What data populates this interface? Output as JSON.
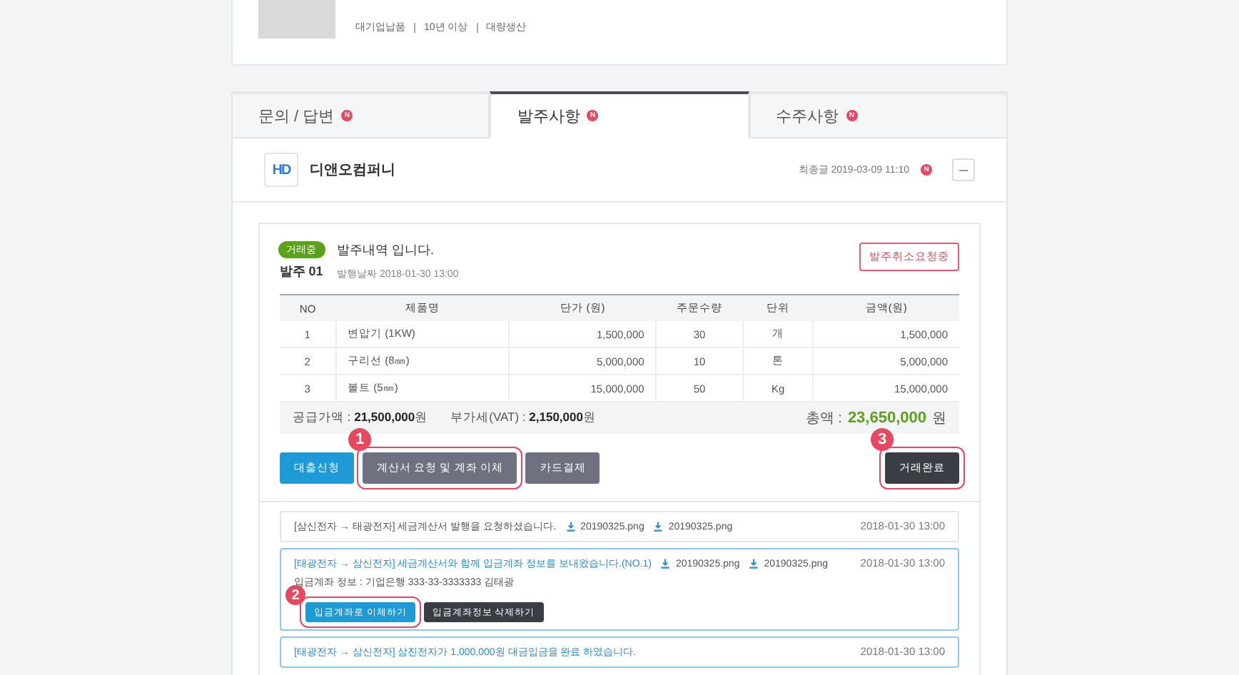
{
  "product": {
    "meta": [
      "대기업납품",
      "10년 이상",
      "대량생산"
    ]
  },
  "tabs": [
    {
      "label": "문의 / 답변",
      "selected": false,
      "badge": "N"
    },
    {
      "label": "발주사항",
      "selected": true,
      "badge": "N"
    },
    {
      "label": "수주사항",
      "selected": false,
      "badge": "N"
    }
  ],
  "company": {
    "logo": "HD",
    "name": "디앤오컴퍼니",
    "last_post": "최종글 2019-03-09 11:10",
    "badge": "N"
  },
  "order": {
    "status": "거래중",
    "number": "발주 01",
    "title": "발주내역 입니다.",
    "date": "발행날짜 2018-01-30 13:00",
    "cancel_button": "발주취소요청중"
  },
  "table": {
    "columns": [
      "NO",
      "제품명",
      "단가 (원)",
      "주문수량",
      "단위",
      "금액(원)"
    ],
    "rows": [
      [
        "1",
        "변압기 (1KW)",
        "1,500,000",
        "30",
        "개",
        "1,500,000"
      ],
      [
        "2",
        "구리선 (8㎜)",
        "5,000,000",
        "10",
        "톤",
        "5,000,000"
      ],
      [
        "3",
        "볼트 (5㎜)",
        "15,000,000",
        "50",
        "Kg",
        "15,000,000"
      ]
    ]
  },
  "summary": {
    "supply": "공급가액 : **21,500,000**원",
    "vat": "부가세(VAT) : **2,150,000**원",
    "total_label": "총액 :",
    "total_value": "23,650,000",
    "total_unit": "원"
  },
  "actions": [
    {
      "label": "대출신청",
      "kind": "primary"
    },
    {
      "label": "계산서 요청 및 계좌 이체",
      "kind": "secondary",
      "step": "1"
    },
    {
      "label": "카드결제",
      "kind": "secondary"
    }
  ],
  "complete_button": {
    "label": "거래완료",
    "step": "3"
  },
  "logs": [
    {
      "text": "[삼신전자 → 태광전자] 세금계산서 발행을 요청하셨습니다.",
      "highlighted": false,
      "files": [
        "20190325.png",
        "20190325.png"
      ],
      "time": "2018-01-30 13:00"
    },
    {
      "text": "[태광전자 → 삼신전자] 세금계산서와 함께 입금계좌 정보를 보내왔습니다.(NO.1)",
      "highlighted": true,
      "files": [
        "20190325.png",
        "20190325.png"
      ],
      "time": "2018-01-30 13:00",
      "detail": "입금계좌 정보 : 기업은행 333-33-3333333 김태광",
      "buttons": [
        {
          "label": "입금계좌로 이체하기",
          "kind": "primary",
          "step": "2"
        },
        {
          "label": "입금계좌정보 삭제하기",
          "kind": "dark"
        }
      ]
    },
    {
      "text": "[태광전자 → 삼신전자] 삼진전자가 1,000,000원 대금입금을 완료 하였습니다.",
      "highlighted": true,
      "time": "2018-01-30 13:00"
    }
  ]
}
